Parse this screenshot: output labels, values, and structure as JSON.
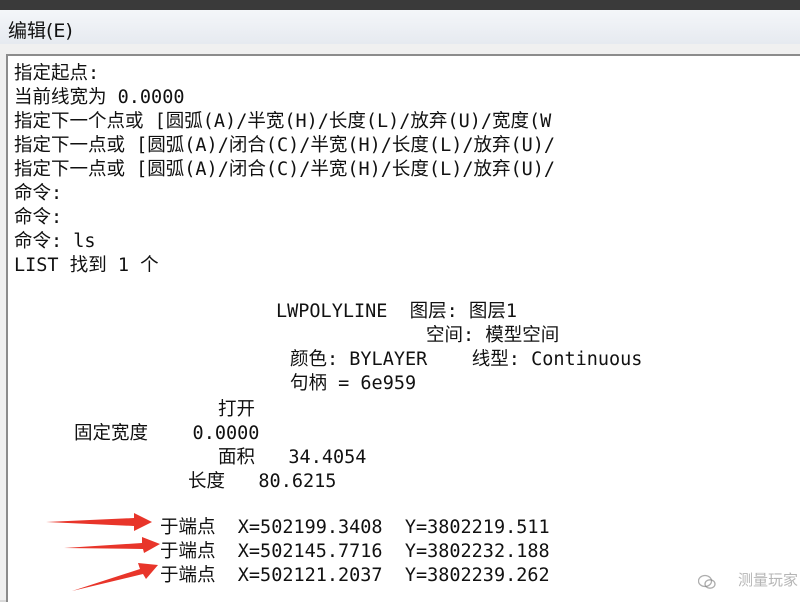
{
  "menu": {
    "edit_label": "编辑(E)"
  },
  "console": {
    "lines": [
      "指定起点:",
      "当前线宽为 0.0000",
      "指定下一个点或 [圆弧(A)/半宽(H)/长度(L)/放弃(U)/宽度(W",
      "指定下一点或 [圆弧(A)/闭合(C)/半宽(H)/长度(L)/放弃(U)/",
      "指定下一点或 [圆弧(A)/闭合(C)/半宽(H)/长度(L)/放弃(U)/",
      "命令:",
      "命令:",
      "命令: ls",
      "LIST 找到 1 个"
    ],
    "entity": {
      "header": "LWPOLYLINE  图层: 图层1",
      "space": "空间: 模型空间",
      "color_linetype": "颜色: BYLAYER    线型: Continuous",
      "handle": "句柄 = 6e959",
      "open": "打开",
      "fixed_width": "固定宽度    0.0000",
      "area": "面积   34.4054",
      "length": "长度   80.6215",
      "vertices": [
        "于端点  X=502199.3408  Y=3802219.511",
        "于端点  X=502145.7716  Y=3802232.188",
        "于端点  X=502121.2037  Y=3802239.262"
      ]
    }
  },
  "annotation_color": "#e8352a",
  "watermark": {
    "text": "测量玩家",
    "icon": "wechat-icon"
  }
}
